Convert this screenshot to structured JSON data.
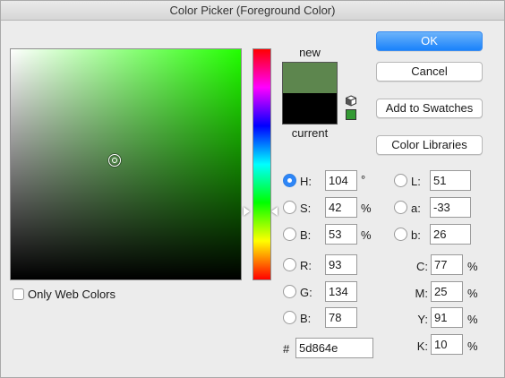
{
  "window": {
    "title": "Color Picker (Foreground Color)"
  },
  "colors": {
    "new": "#5d864e",
    "current": "#000000",
    "accent": "#1a82fb"
  },
  "preview": {
    "new_label": "new",
    "current_label": "current"
  },
  "buttons": {
    "ok": "OK",
    "cancel": "Cancel",
    "add_to_swatches": "Add to Swatches",
    "color_libraries": "Color Libraries"
  },
  "hsb": {
    "h": {
      "label": "H:",
      "value": "104",
      "unit": "°"
    },
    "s": {
      "label": "S:",
      "value": "42",
      "unit": "%"
    },
    "b": {
      "label": "B:",
      "value": "53",
      "unit": "%"
    }
  },
  "rgb": {
    "r": {
      "label": "R:",
      "value": "93"
    },
    "g": {
      "label": "G:",
      "value": "134"
    },
    "b": {
      "label": "B:",
      "value": "78"
    }
  },
  "lab": {
    "l": {
      "label": "L:",
      "value": "51"
    },
    "a": {
      "label": "a:",
      "value": "-33"
    },
    "b": {
      "label": "b:",
      "value": "26"
    }
  },
  "cmyk": {
    "c": {
      "label": "C:",
      "value": "77",
      "unit": "%"
    },
    "m": {
      "label": "M:",
      "value": "25",
      "unit": "%"
    },
    "y": {
      "label": "Y:",
      "value": "91",
      "unit": "%"
    },
    "k": {
      "label": "K:",
      "value": "10",
      "unit": "%"
    }
  },
  "hex": {
    "label": "#",
    "value": "5d864e"
  },
  "web_only": {
    "label": "Only Web Colors",
    "checked": false
  },
  "selected_channel": "H"
}
